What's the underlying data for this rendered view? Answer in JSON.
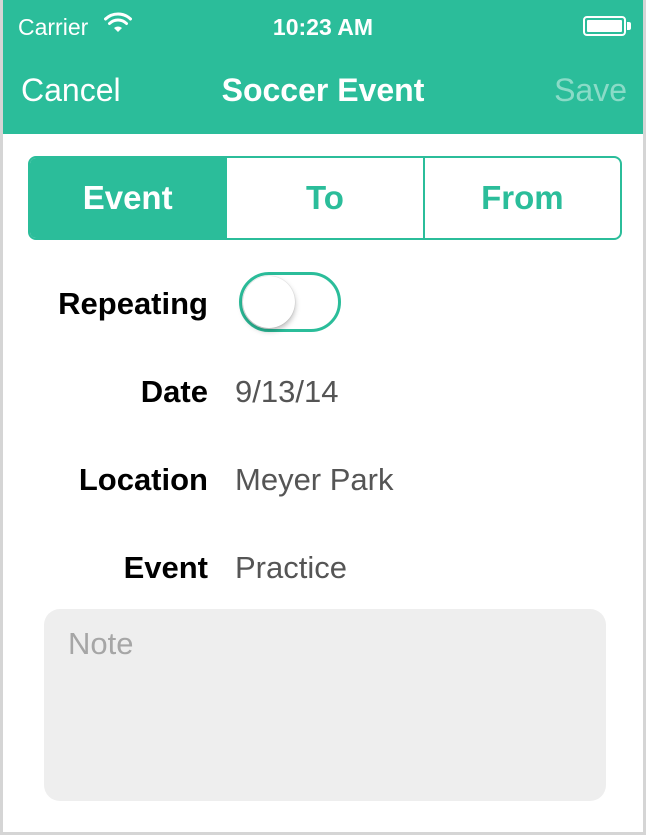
{
  "theme": {
    "accent": "#2bbd9a"
  },
  "status_bar": {
    "carrier": "Carrier",
    "wifi_icon": "wifi-icon",
    "time": "10:23 AM",
    "battery_icon": "battery-icon"
  },
  "nav": {
    "cancel_label": "Cancel",
    "title": "Soccer Event",
    "save_label": "Save"
  },
  "segments": {
    "selected": "Event",
    "items": [
      {
        "label": "Event"
      },
      {
        "label": "To"
      },
      {
        "label": "From"
      }
    ]
  },
  "form": {
    "repeating": {
      "label": "Repeating",
      "value": "off"
    },
    "date": {
      "label": "Date",
      "value": "9/13/14"
    },
    "location": {
      "label": "Location",
      "value": "Meyer Park"
    },
    "event": {
      "label": "Event",
      "value": "Practice"
    },
    "note": {
      "placeholder": "Note",
      "value": ""
    }
  }
}
